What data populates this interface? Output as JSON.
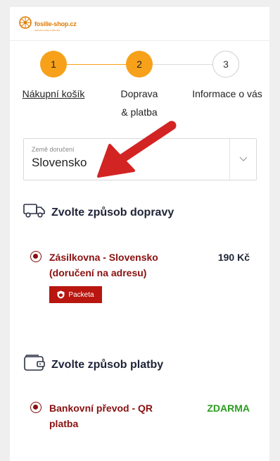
{
  "header": {
    "logo_name": "fosilie-shop.cz",
    "logo_tagline": "jedinečné dárky a dekorace"
  },
  "steps": [
    {
      "number": "1",
      "label": "Nákupní košík"
    },
    {
      "number": "2",
      "label_line1": "Doprava",
      "label_line2": "& platba"
    },
    {
      "number": "3",
      "label": "Informace o vás"
    }
  ],
  "country": {
    "label": "Země doručení",
    "value": "Slovensko"
  },
  "shipping": {
    "title": "Zvolte způsob dopravy",
    "option_name_line1": "Zásilkovna - Slovensko",
    "option_name_line2": "(doručení na adresu)",
    "option_price": "190 Kč",
    "badge": "Packeta"
  },
  "payment": {
    "title": "Zvolte způsob platby",
    "option_name_line1": "Bankovní převod - QR",
    "option_name_line2": "platba",
    "option_price": "ZDARMA"
  },
  "colors": {
    "accent": "#f7a11a",
    "radio": "#8c0e0e",
    "option_text": "#8a1010",
    "free_price": "#2a9d1f",
    "packeta": "#b8160f",
    "arrow": "#d32424"
  },
  "icons": [
    "truck-icon",
    "wallet-icon",
    "chevron-down-icon",
    "packeta-shield-icon",
    "logo-wheel-icon"
  ]
}
